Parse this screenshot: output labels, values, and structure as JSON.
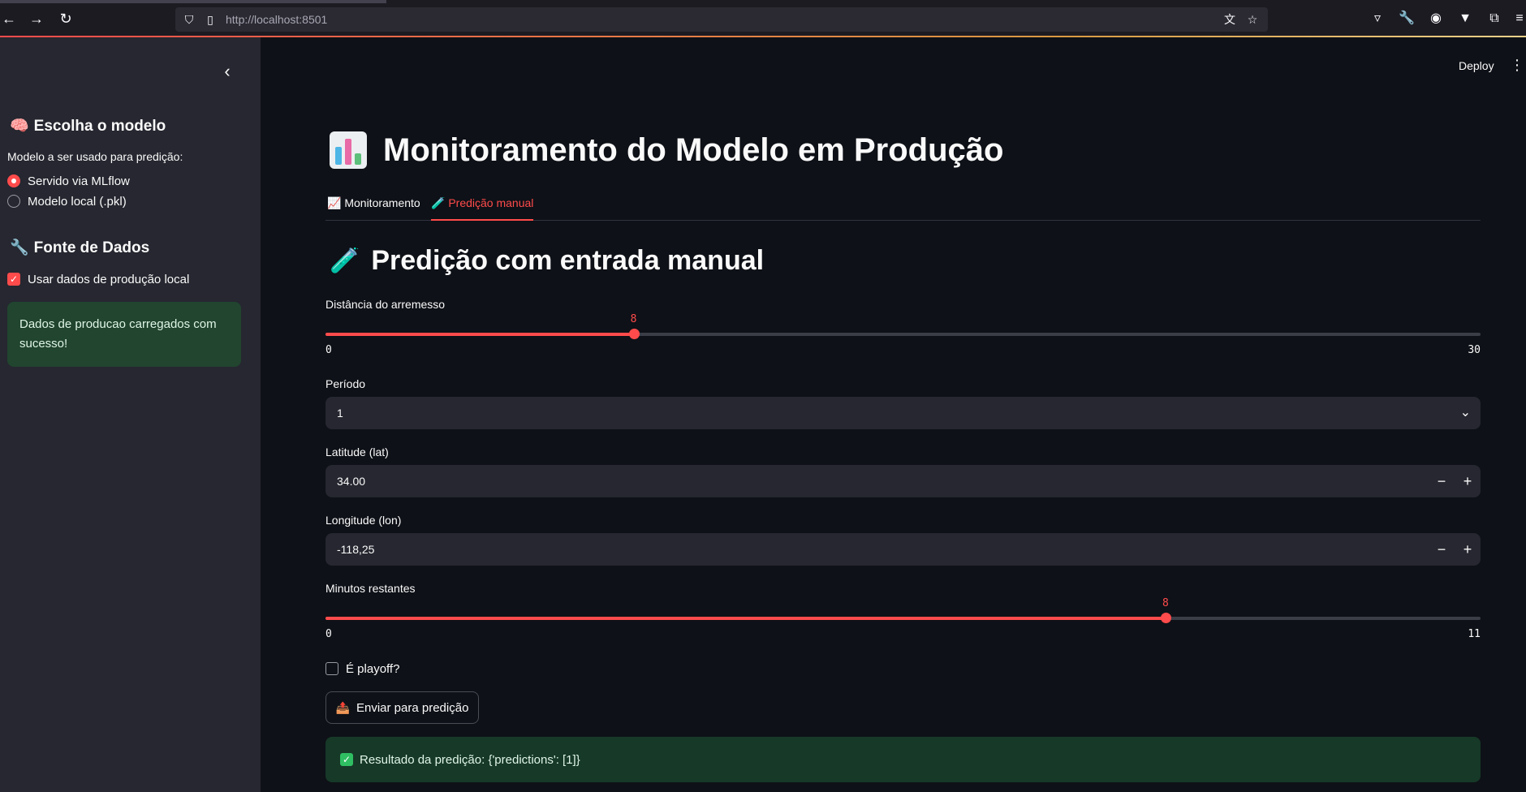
{
  "browser": {
    "url_host": "http://localhost",
    "url_port": ":8501"
  },
  "header": {
    "deploy_label": "Deploy"
  },
  "sidebar": {
    "model_section_title": "Escolha o modelo",
    "model_radio_label": "Modelo a ser usado para predição:",
    "model_options": [
      "Servido via MLflow",
      "Modelo local (.pkl)"
    ],
    "model_selected": "Servido via MLflow",
    "data_section_title": "Fonte de Dados",
    "use_local_data_label": "Usar dados de produção local",
    "use_local_data_checked": true,
    "success_message": "Dados de producao carregados com sucesso!"
  },
  "main": {
    "title": "Monitoramento do Modelo em Produção",
    "tabs": [
      {
        "label": "Monitoramento",
        "active": false
      },
      {
        "label": "Predição manual",
        "active": true
      }
    ],
    "subtitle": "Predição com entrada manual",
    "distance": {
      "label": "Distância do arremesso",
      "value": "8",
      "min": "0",
      "max": "30",
      "fraction": 0.2667
    },
    "period": {
      "label": "Período",
      "value": "1"
    },
    "latitude": {
      "label": "Latitude (lat)",
      "value": "34.00"
    },
    "longitude": {
      "label": "Longitude (lon)",
      "value": "-118,25"
    },
    "minutes": {
      "label": "Minutos restantes",
      "value": "8",
      "min": "0",
      "max": "11",
      "fraction": 0.7273
    },
    "playoff": {
      "label": "É playoff?",
      "checked": false
    },
    "submit_label": "Enviar para predição",
    "result_text": "Resultado da predição: {'predictions': [1]}"
  },
  "colors": {
    "accent": "#ff4b4b",
    "background": "#0e1117",
    "sidebar": "#262730",
    "success_bg": "#173928"
  }
}
